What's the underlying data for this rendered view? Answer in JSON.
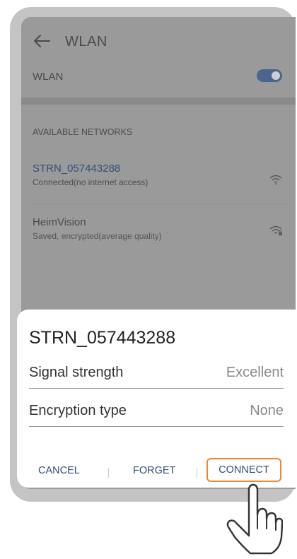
{
  "header": {
    "title": "WLAN"
  },
  "wlan": {
    "label": "WLAN",
    "enabled": true
  },
  "section": {
    "available": "AVAILABLE NETWORKS"
  },
  "networks": [
    {
      "name": "STRN_057443288",
      "status": "Connected(no internet access)"
    },
    {
      "name": "HeimVision",
      "status": "Saved, encrypted(average quality)"
    }
  ],
  "dialog": {
    "title": "STRN_057443288",
    "rows": [
      {
        "label": "Signal strength",
        "value": "Excellent"
      },
      {
        "label": "Encryption type",
        "value": "None"
      }
    ],
    "actions": {
      "cancel": "CANCEL",
      "forget": "FORGET",
      "connect": "CONNECT"
    }
  },
  "colors": {
    "accent": "#2f4f7c",
    "highlight": "#e88a2d",
    "toggle_on": "#4a6590"
  },
  "icons": [
    "back-arrow-icon",
    "wifi-icon",
    "wifi-lock-icon",
    "pointing-hand-icon"
  ]
}
